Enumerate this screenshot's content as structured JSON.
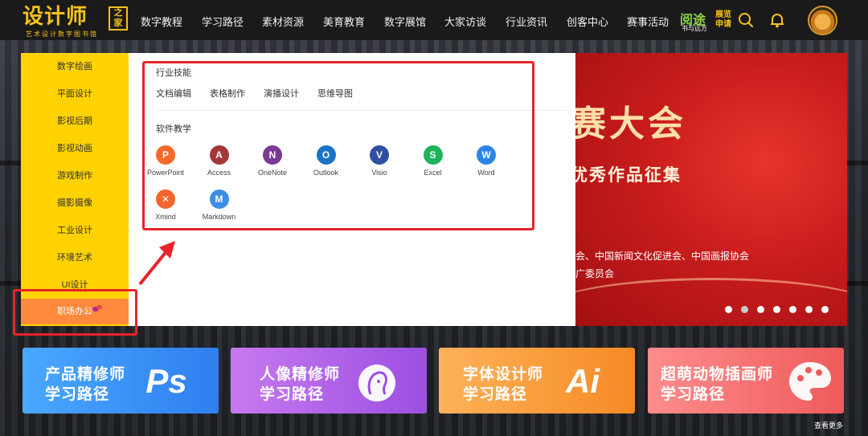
{
  "header": {
    "logo_text": "设计师",
    "logo_box_text": "之家",
    "logo_tagline": "艺术设计数字图书馆",
    "nav": [
      "数字教程",
      "学习路径",
      "素材资源",
      "美育教育",
      "数字展馆",
      "大家访谈",
      "行业资讯",
      "创客中心",
      "赛事活动"
    ],
    "badge_main": "阅途",
    "badge_sub": "书与远方",
    "badge_apply": "展览申请",
    "icons": [
      "search-icon",
      "bell-icon",
      "avatar"
    ]
  },
  "sidebar": {
    "items": [
      "数字绘画",
      "平面设计",
      "影视后期",
      "影视动画",
      "游戏制作",
      "摄影摄像",
      "工业设计",
      "环境艺术",
      "UI设计",
      "职场办公"
    ],
    "active": "职场办公"
  },
  "dropdown": {
    "section1_title": "行业技能",
    "section1_links": [
      "文档编辑",
      "表格制作",
      "演播设计",
      "思维导图"
    ],
    "section2_title": "软件教学",
    "apps": [
      {
        "label": "PowerPoint",
        "glyph": "P",
        "color": "#f26b2a"
      },
      {
        "label": "Access",
        "glyph": "A",
        "color": "#a4373a"
      },
      {
        "label": "OneNote",
        "glyph": "N",
        "color": "#7b3a96"
      },
      {
        "label": "Outlook",
        "glyph": "O",
        "color": "#1a73c8"
      },
      {
        "label": "Visio",
        "glyph": "V",
        "color": "#2e4fa1"
      },
      {
        "label": "Excel",
        "glyph": "S",
        "color": "#1fb35a"
      },
      {
        "label": "Word",
        "glyph": "W",
        "color": "#2a86e6"
      },
      {
        "label": "Xmind",
        "glyph": "✕",
        "color": "#f2652c"
      },
      {
        "label": "Markdown",
        "glyph": "M",
        "color": "#3a8ee6"
      }
    ]
  },
  "banner": {
    "title": "赛大会",
    "subtitle": "优秀作品征集",
    "org_line1": "会、中国新闻文化促进会、中国画报协会",
    "org_line2": "广委员会",
    "slides": 7,
    "active_slide": 2
  },
  "cards": [
    {
      "line1": "产品精修师",
      "line2": "学习路径",
      "logo": "Ps",
      "color_from": "#4aa8ff",
      "color_to": "#2f7ff0"
    },
    {
      "line1": "人像精修师",
      "line2": "学习路径",
      "logo": "",
      "color_from": "#c779f0",
      "color_to": "#9b4fe0"
    },
    {
      "line1": "字体设计师",
      "line2": "学习路径",
      "logo": "Ai",
      "color_from": "#ffb259",
      "color_to": "#f58a24"
    },
    {
      "line1": "超萌动物插画师",
      "line2": "学习路径",
      "logo": "",
      "color_from": "#ff8c8c",
      "color_to": "#ee5b5b"
    }
  ],
  "more_link": "查看更多"
}
